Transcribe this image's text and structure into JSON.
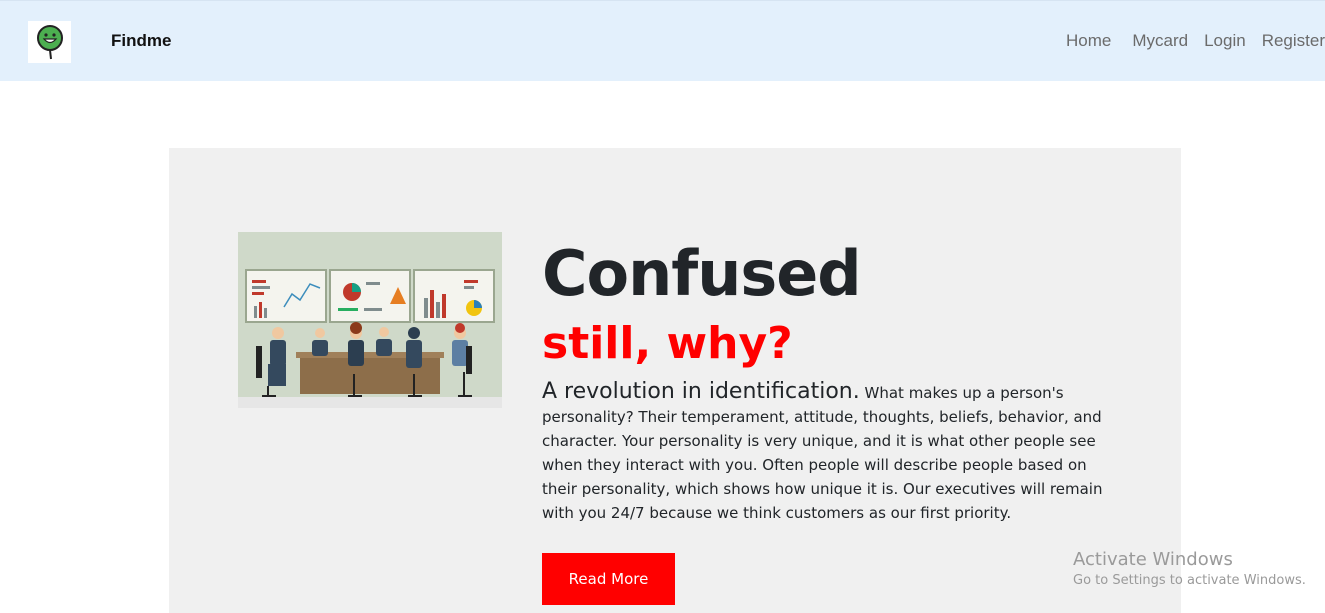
{
  "navbar": {
    "brand": "Findme",
    "logo_icon": "smiley-magnifier-icon",
    "links": [
      "Home",
      "Mycard",
      "Login",
      "Register"
    ]
  },
  "hero": {
    "illustration": "business-meeting-illustration",
    "heading": "Confused",
    "subheading": "still, why?",
    "lead": "A revolution in identification.",
    "body": "What makes up a person's personality? Their temperament, attitude, thoughts, beliefs, behavior, and character. Your personality is very unique, and it is what other people see when they interact with you. Often people will describe people based on their personality, which shows how unique it is. Our executives will remain with you 24/7 because we think customers as our first priority.",
    "button_label": "Read More"
  },
  "watermark": {
    "title": "Activate Windows",
    "subtitle": "Go to Settings to activate Windows."
  },
  "colors": {
    "navbar_bg": "#e3f0fc",
    "hero_bg": "#f0f0f0",
    "accent": "#ff0000",
    "heading": "#212529"
  }
}
